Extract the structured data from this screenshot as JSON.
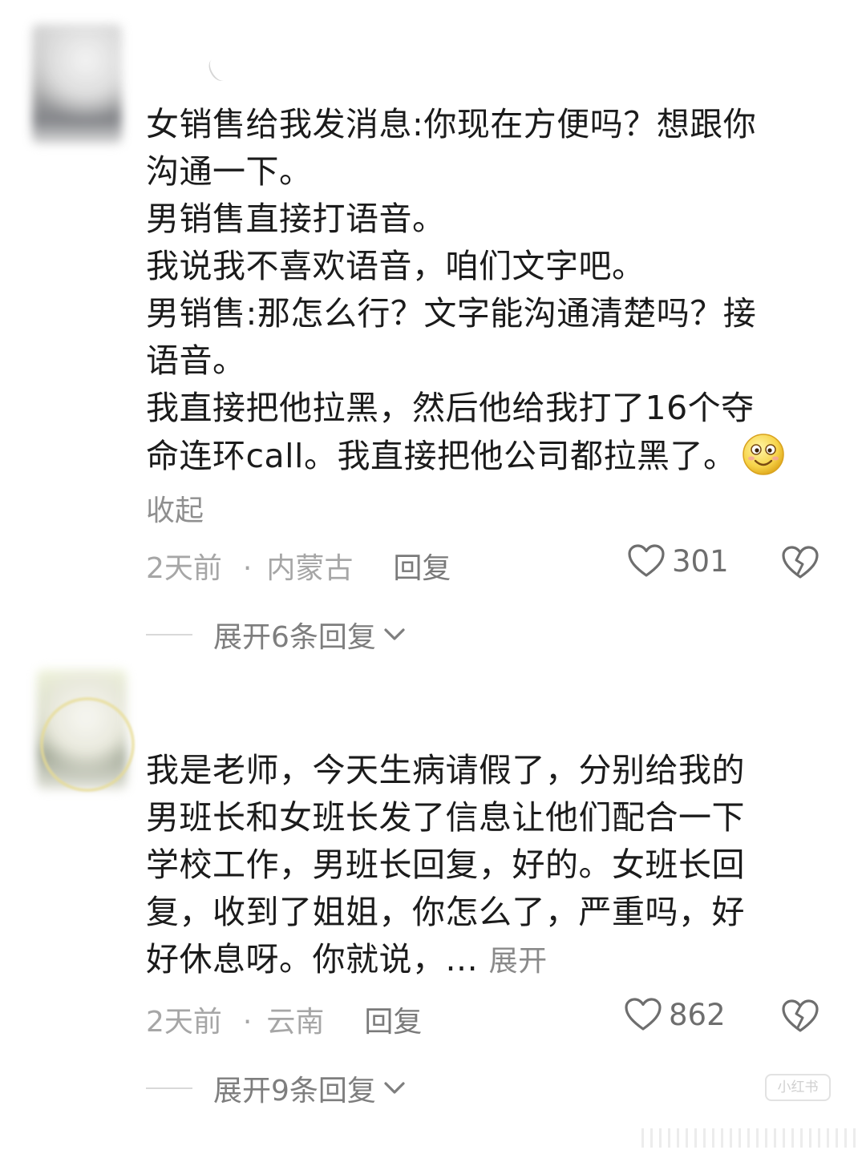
{
  "comments": [
    {
      "lines": [
        "女销售给我发消息:你现在方便吗？想跟你",
        "沟通一下。",
        "男销售直接打语音。",
        "我说我不喜欢语音，咱们文字吧。",
        "男销售:那怎么行？文字能沟通清楚吗？接",
        "语音。",
        "我直接把他拉黑，然后他给我打了16个夺",
        "命连环call。我直接把他公司都拉黑了。"
      ],
      "emoji": "smiling-emoji",
      "collapse_label": "收起",
      "time": "2天前",
      "separator": "·",
      "location": "内蒙古",
      "reply_label": "回复",
      "likes": "301",
      "expand_label": "展开6条回复"
    },
    {
      "lines": [
        "我是老师，今天生病请假了，分别给我的",
        "男班长和女班长发了信息让他们配合一下",
        "学校工作，男班长回复，好的。女班长回",
        "复，收到了姐姐，你怎么了，严重吗，好",
        "好休息呀。你就说，..."
      ],
      "more_label": "展开",
      "time": "2天前",
      "separator": "·",
      "location": "云南",
      "reply_label": "回复",
      "likes": "862",
      "expand_label": "展开9条回复"
    }
  ],
  "watermark": "小红书",
  "icons": {
    "like": "heart-outline-icon",
    "dislike": "broken-heart-icon",
    "expand": "chevron-down-icon"
  },
  "colors": {
    "text": "#1b1b1b",
    "meta": "#a6a6a6",
    "icon": "#6e6e6e"
  }
}
